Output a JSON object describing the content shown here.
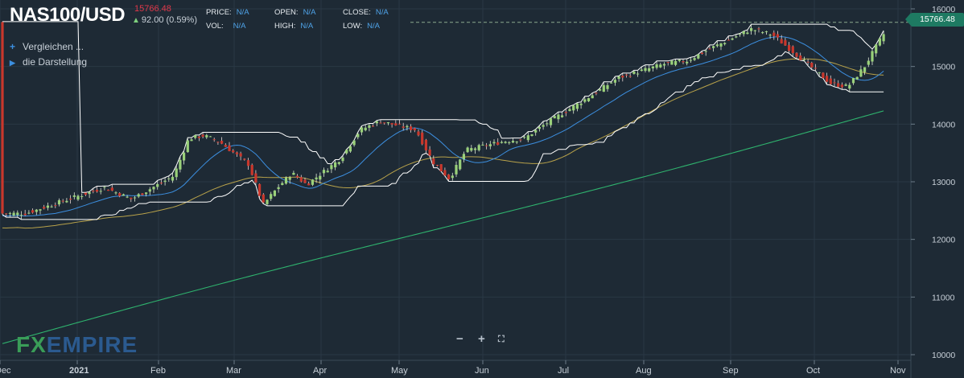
{
  "header": {
    "symbol": "NAS100/USD",
    "last_price": "15766.48",
    "change": "92.00 (0.59%)",
    "stats": [
      {
        "label": "PRICE:",
        "value": "N/A"
      },
      {
        "label": "OPEN:",
        "value": "N/A"
      },
      {
        "label": "CLOSE:",
        "value": "N/A"
      },
      {
        "label": "VOL:",
        "value": "N/A"
      },
      {
        "label": "HIGH:",
        "value": "N/A"
      },
      {
        "label": "LOW:",
        "value": "N/A"
      }
    ]
  },
  "menu": {
    "compare_label": "Vergleichen ...",
    "display_label": "die Darstellung"
  },
  "logo": {
    "fx": "FX",
    "empire": "EMPIRE"
  },
  "zoom_controls": [
    "−",
    "+",
    "⛶"
  ],
  "colors": {
    "background": "#1e2a35",
    "candle_up": "#9ad17a",
    "candle_down": "#c9372c",
    "sma_fast": "#3c8fe0",
    "sma_mid": "#b8a24a",
    "sma_slow": "#2fb36e",
    "channel": "#ffffff",
    "price_tag": "#1e7a62"
  },
  "chart_data": {
    "type": "candlestick",
    "y_axis": {
      "ticks": [
        10000,
        11000,
        12000,
        13000,
        14000,
        15000,
        16000
      ],
      "range": [
        9950,
        16200
      ],
      "position": "right"
    },
    "x_axis": {
      "labels": [
        "Dec",
        "2021",
        "Feb",
        "Mar",
        "Apr",
        "May",
        "Jun",
        "Jul",
        "Aug",
        "Sep",
        "Oct",
        "Nov"
      ]
    },
    "last_price_tag": 15766.48,
    "close_path": [
      [
        "Dec",
        12450
      ],
      [
        "Dec",
        12600
      ],
      [
        "2021",
        12900
      ],
      [
        "2021",
        12700
      ],
      [
        "Feb",
        13100
      ],
      [
        "Feb",
        13750
      ],
      [
        "Feb",
        13800
      ],
      [
        "Feb",
        13700
      ],
      [
        "Mar",
        13300
      ],
      [
        "Mar",
        12600
      ],
      [
        "Mar",
        12900
      ],
      [
        "Mar",
        13150
      ],
      [
        "Mar",
        12950
      ],
      [
        "Apr",
        13400
      ],
      [
        "Apr",
        13900
      ],
      [
        "Apr",
        14050
      ],
      [
        "May",
        13900
      ],
      [
        "May",
        13350
      ],
      [
        "May",
        13050
      ],
      [
        "May",
        13550
      ],
      [
        "Jun",
        13700
      ],
      [
        "Jun",
        13750
      ],
      [
        "Jun",
        14000
      ],
      [
        "Jul",
        14500
      ],
      [
        "Jul",
        14800
      ],
      [
        "Aug",
        15050
      ],
      [
        "Aug",
        15100
      ],
      [
        "Aug",
        15300
      ],
      [
        "Sep",
        15650
      ],
      [
        "Sep",
        15550
      ],
      [
        "Sep",
        15250
      ],
      [
        "Oct",
        14700
      ],
      [
        "Oct",
        14650
      ],
      [
        "Oct",
        15000
      ],
      [
        "Oct",
        15500
      ],
      [
        "Nov",
        15766
      ]
    ],
    "overlays": [
      "SMA fast",
      "SMA mid",
      "SMA slow",
      "Price channel"
    ]
  }
}
